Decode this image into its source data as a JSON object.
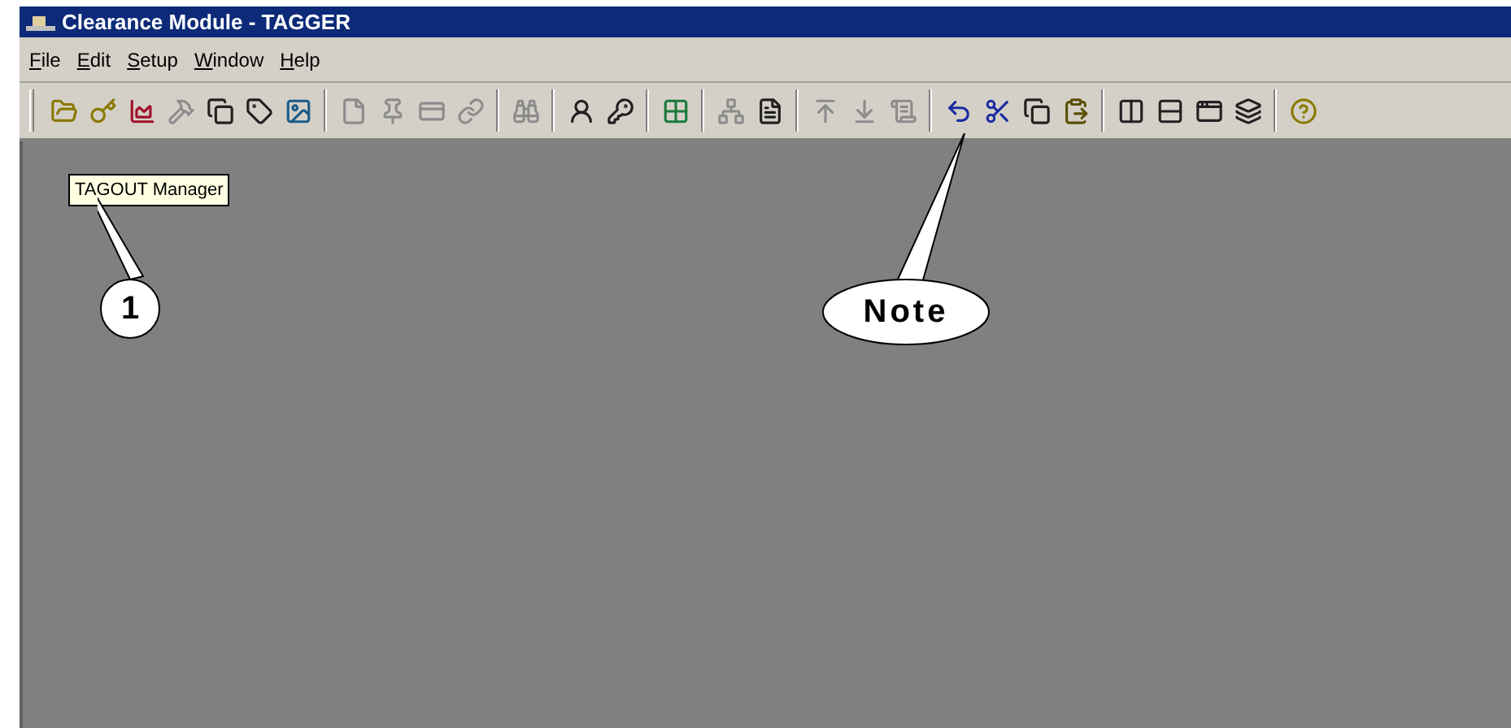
{
  "window": {
    "title": "Clearance Module - TAGGER"
  },
  "menu": [
    "File",
    "Edit",
    "Setup",
    "Window",
    "Help"
  ],
  "toolbar": [
    [
      {
        "kind": "folder",
        "disabled": false
      },
      {
        "kind": "key",
        "disabled": false
      },
      {
        "kind": "chart",
        "disabled": false
      },
      {
        "kind": "tool",
        "disabled": true
      },
      {
        "kind": "copy",
        "disabled": false
      },
      {
        "kind": "tag",
        "disabled": false
      },
      {
        "kind": "image",
        "disabled": false
      }
    ],
    [
      {
        "kind": "file",
        "disabled": true
      },
      {
        "kind": "pin",
        "disabled": true
      },
      {
        "kind": "card",
        "disabled": true
      },
      {
        "kind": "link",
        "disabled": true
      }
    ],
    [
      {
        "kind": "binoculars",
        "disabled": true
      }
    ],
    [
      {
        "kind": "person",
        "disabled": false
      },
      {
        "kind": "keyh",
        "disabled": false
      }
    ],
    [
      {
        "kind": "grid",
        "disabled": false
      }
    ],
    [
      {
        "kind": "tree",
        "disabled": true
      },
      {
        "kind": "doc",
        "disabled": false
      }
    ],
    [
      {
        "kind": "up",
        "disabled": true
      },
      {
        "kind": "down",
        "disabled": true
      },
      {
        "kind": "scroll",
        "disabled": true
      }
    ],
    [
      {
        "kind": "undo",
        "disabled": false
      },
      {
        "kind": "cut",
        "disabled": false
      },
      {
        "kind": "copy",
        "disabled": false
      },
      {
        "kind": "paste",
        "disabled": false
      }
    ],
    [
      {
        "kind": "cols",
        "disabled": false
      },
      {
        "kind": "rows",
        "disabled": false
      },
      {
        "kind": "window",
        "disabled": false
      },
      {
        "kind": "cascade",
        "disabled": false
      }
    ],
    [
      {
        "kind": "help",
        "disabled": false
      }
    ]
  ],
  "tooltip": "TAGOUT Manager",
  "callouts": [
    {
      "label": "1",
      "kind": "circle"
    },
    {
      "label": "Note",
      "kind": "ellipse"
    }
  ]
}
